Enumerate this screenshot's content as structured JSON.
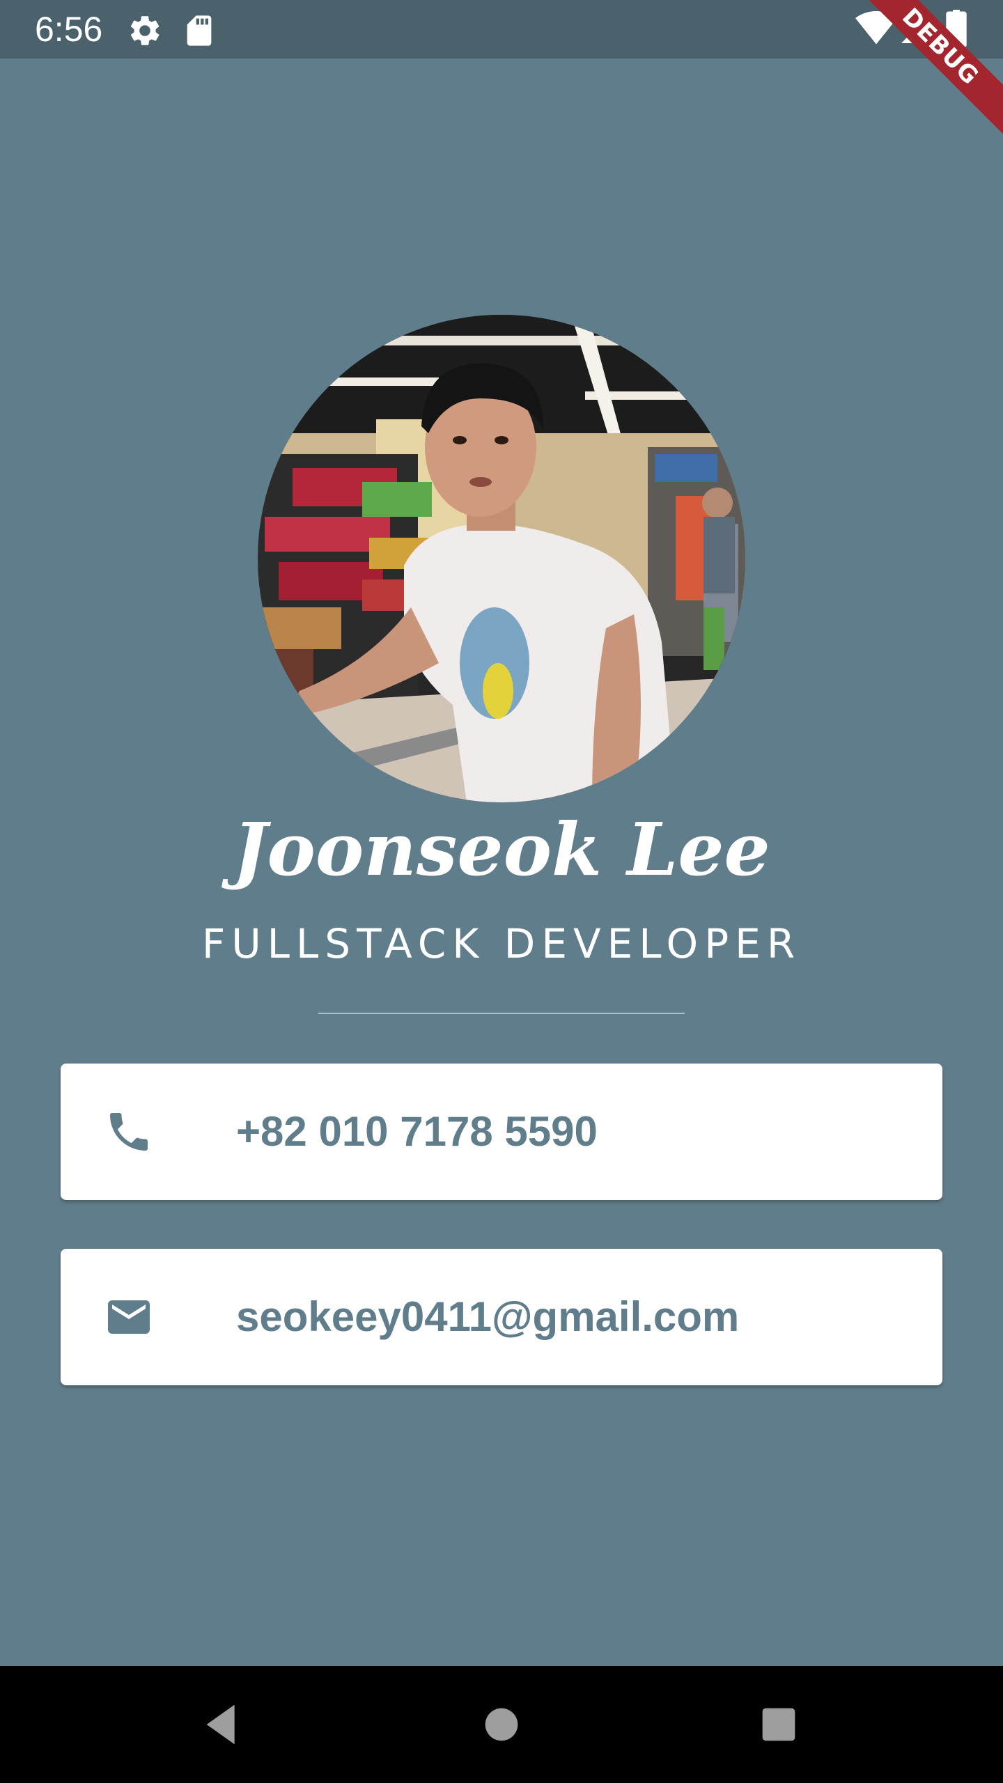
{
  "status_bar": {
    "time": "6:56",
    "icons": [
      "settings-icon",
      "sd-card-icon",
      "wifi-icon",
      "cellular-signal-icon",
      "battery-icon"
    ]
  },
  "debug_banner": "DEBUG",
  "profile": {
    "name": "Joonseok Lee",
    "title": "FULLSTACK DEVELOPER"
  },
  "contacts": {
    "phone": "+82 010 7178 5590",
    "email": "seokeey0411@gmail.com"
  },
  "nav_bar": {
    "icons": [
      "back-icon",
      "home-icon",
      "recents-icon"
    ]
  },
  "colors": {
    "background": "#607d8b",
    "status_bar": "#4b626d",
    "card": "#ffffff",
    "accent_text": "#607d8b",
    "debug_banner": "#a3252d"
  }
}
